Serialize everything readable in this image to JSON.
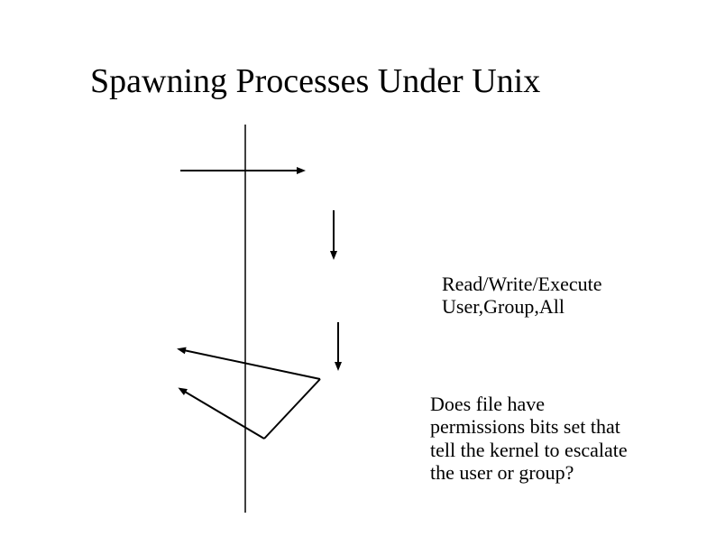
{
  "title": "Spawning Processes Under Unix",
  "label1_line1": "Read/Write/Execute",
  "label1_line2": "User,Group,All",
  "label2": "Does file have permissions bits set that tell the kernel to escalate the user or group?"
}
